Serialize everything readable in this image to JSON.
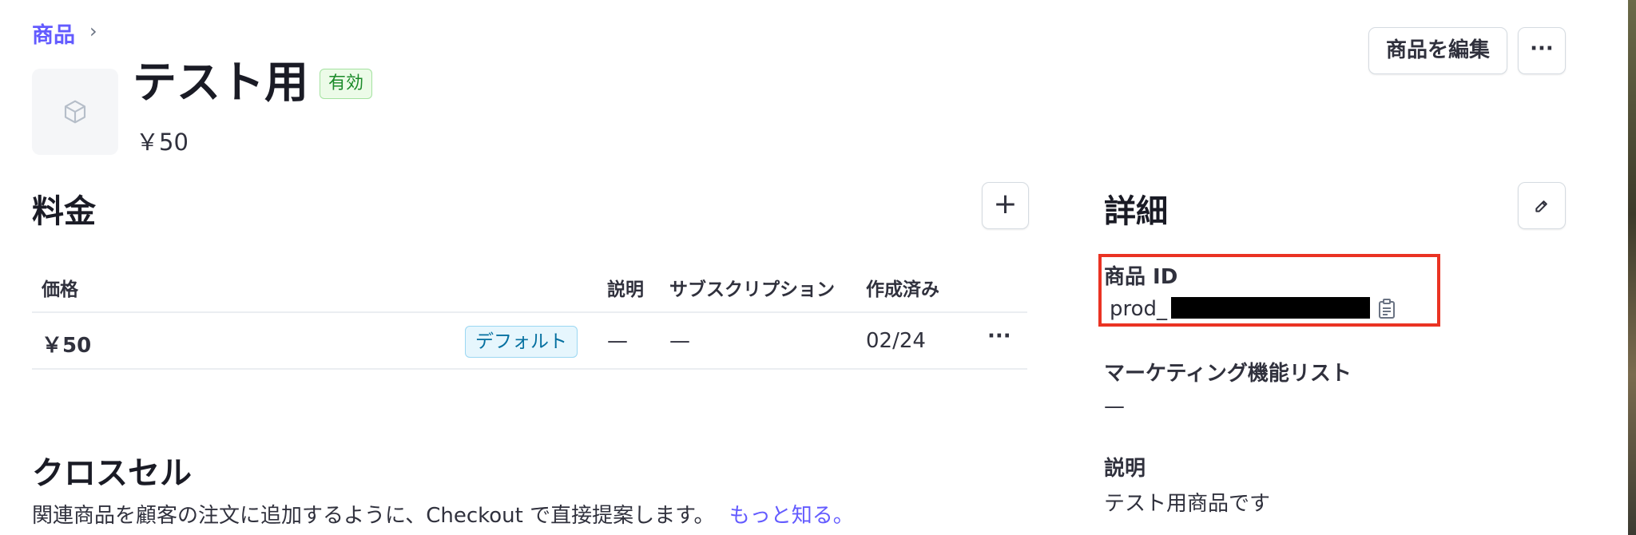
{
  "breadcrumb": {
    "parent": "商品",
    "chevron": "›"
  },
  "product": {
    "name": "テスト用",
    "status": "有効",
    "price": "￥50",
    "image_icon": "cube-icon"
  },
  "header_actions": {
    "edit_label": "商品を編集",
    "more_label": "···"
  },
  "pricing": {
    "title": "料金",
    "add_label": "+",
    "columns": [
      "価格",
      "説明",
      "サブスクリプション",
      "作成済み"
    ],
    "rows": [
      {
        "price": "￥50",
        "badge": "デフォルト",
        "description": "—",
        "subscriptions": "—",
        "created": "02/24",
        "more": "···"
      }
    ]
  },
  "cross_sell": {
    "title": "クロスセル",
    "description": "関連商品を顧客の注文に追加するように、Checkout で直接提案します。",
    "link": "もっと知る。"
  },
  "details": {
    "title": "詳細",
    "edit_icon": "pencil-icon",
    "product_id_label": "商品 ID",
    "product_id_prefix": "prod_",
    "copy_icon": "clipboard-icon",
    "marketing_label": "マーケティング機能リスト",
    "marketing_value": "—",
    "description_label": "説明",
    "description_value": "テスト用商品です"
  },
  "colors": {
    "accent": "#635bff",
    "highlight_box": "#ea3323"
  }
}
